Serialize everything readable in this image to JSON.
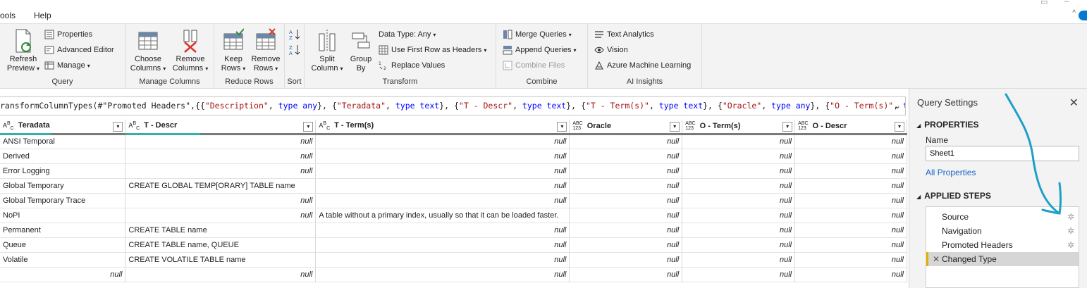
{
  "menu": {
    "tools_partial": "ools",
    "help": "Help"
  },
  "ribbon": {
    "query": {
      "label": "Query",
      "refresh_line1": "Refresh",
      "refresh_line2": "Preview",
      "properties": "Properties",
      "advanced_editor": "Advanced Editor",
      "manage": "Manage"
    },
    "manage_columns": {
      "label": "Manage Columns",
      "choose_line1": "Choose",
      "choose_line2": "Columns",
      "remove_line1": "Remove",
      "remove_line2": "Columns"
    },
    "reduce_rows": {
      "label": "Reduce Rows",
      "keep_line1": "Keep",
      "keep_line2": "Rows",
      "remove_line1": "Remove",
      "remove_line2": "Rows"
    },
    "sort": {
      "label": "Sort"
    },
    "transform": {
      "label": "Transform",
      "split_line1": "Split",
      "split_line2": "Column",
      "group_line1": "Group",
      "group_line2": "By",
      "data_type": "Data Type: Any",
      "first_row_headers": "Use First Row as Headers",
      "replace_values": "Replace Values"
    },
    "combine": {
      "label": "Combine",
      "merge": "Merge Queries",
      "append": "Append Queries",
      "combine_files": "Combine Files"
    },
    "ai": {
      "label": "AI Insights",
      "text_analytics": "Text Analytics",
      "vision": "Vision",
      "azure_ml": "Azure Machine Learning"
    }
  },
  "formula": {
    "p1": "ransformColumnTypes(#\"Promoted Headers\",{{",
    "s1": "\"Description\"",
    "p2": ", ",
    "k1": "type any",
    "p3": "}, {",
    "s2": "\"Teradata\"",
    "p4": ", ",
    "k2": "type text",
    "p5": "}, {",
    "s3": "\"T - Descr\"",
    "p6": ", ",
    "k3": "type text",
    "p7": "}, {",
    "s4": "\"T - Term(s)\"",
    "p8": ", ",
    "k4": "type text",
    "p9": "}, {",
    "s5": "\"Oracle\"",
    "p10": ", ",
    "k5": "type any",
    "p11": "}, {",
    "s6": "\"O - Term(s)\"",
    "p12": ", ",
    "k6": "type"
  },
  "grid": {
    "columns": [
      {
        "name": "Teradata",
        "type": "ABC"
      },
      {
        "name": "T - Descr",
        "type": "ABC"
      },
      {
        "name": "T - Term(s)",
        "type": "ABC"
      },
      {
        "name": "Oracle",
        "type": "ABC123"
      },
      {
        "name": "O - Term(s)",
        "type": "ABC123"
      },
      {
        "name": "O - Descr",
        "type": "ABC123"
      }
    ],
    "rows": [
      [
        "ANSI Temporal",
        null,
        null,
        null,
        null,
        null
      ],
      [
        "Derived",
        null,
        null,
        null,
        null,
        null
      ],
      [
        "Error Logging",
        null,
        null,
        null,
        null,
        null
      ],
      [
        "Global Temporary",
        "CREATE GLOBAL TEMP[ORARY] TABLE name",
        null,
        null,
        null,
        null
      ],
      [
        "Global Temporary Trace",
        null,
        null,
        null,
        null,
        null
      ],
      [
        "NoPI",
        null,
        "A table without a primary index, usually so that it can be loaded faster.",
        null,
        null,
        null
      ],
      [
        "Permanent",
        "CREATE TABLE name",
        null,
        null,
        null,
        null
      ],
      [
        "Queue",
        "CREATE TABLE name, QUEUE",
        null,
        null,
        null,
        null
      ],
      [
        "Volatile",
        "CREATE VOLATILE TABLE name",
        null,
        null,
        null,
        null
      ],
      [
        null,
        null,
        null,
        null,
        null,
        null
      ]
    ],
    "null_text": "null"
  },
  "query_settings": {
    "title": "Query Settings",
    "properties_heading": "PROPERTIES",
    "name_label": "Name",
    "name_value": "Sheet1",
    "all_properties": "All Properties",
    "applied_steps_heading": "APPLIED STEPS",
    "steps": [
      "Source",
      "Navigation",
      "Promoted Headers",
      "Changed Type"
    ]
  },
  "colors": {
    "accent_blue": "#1ea0c8",
    "active_step_bar": "#e0b000",
    "quality_bar": "#35b0a8"
  }
}
